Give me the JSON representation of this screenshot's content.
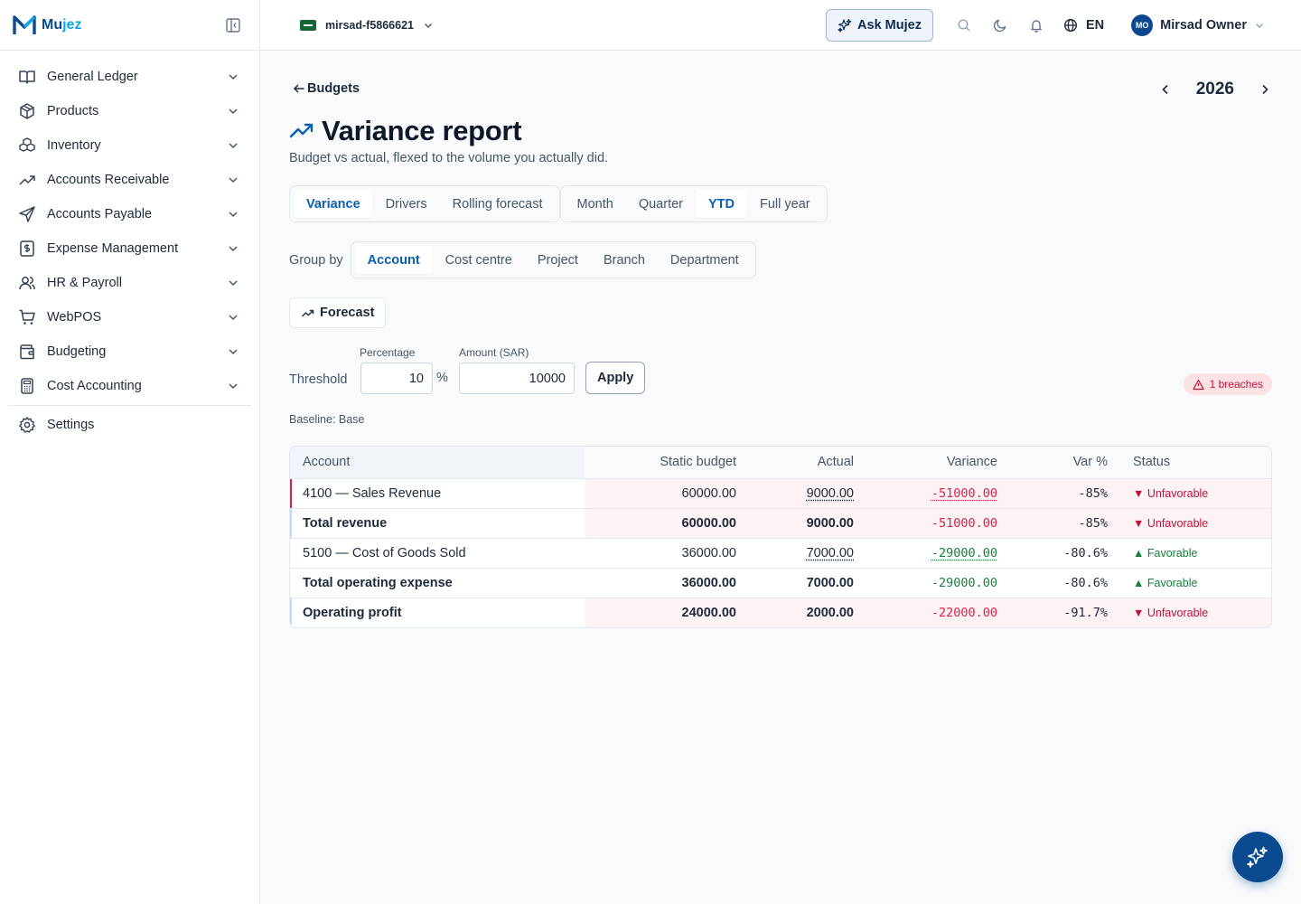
{
  "app": {
    "name_prefix": "Mu",
    "name_suffix": "jez"
  },
  "sidebar": {
    "items": [
      {
        "label": "General Ledger",
        "icon": "book-open-icon"
      },
      {
        "label": "Products",
        "icon": "box-icon"
      },
      {
        "label": "Inventory",
        "icon": "boxes-icon"
      },
      {
        "label": "Accounts Receivable",
        "icon": "trend-up-icon"
      },
      {
        "label": "Accounts Payable",
        "icon": "send-icon"
      },
      {
        "label": "Expense Management",
        "icon": "receipt-icon"
      },
      {
        "label": "HR & Payroll",
        "icon": "users-icon"
      },
      {
        "label": "WebPOS",
        "icon": "cart-icon"
      },
      {
        "label": "Budgeting",
        "icon": "wallet-icon"
      },
      {
        "label": "Cost Accounting",
        "icon": "calculator-icon"
      }
    ],
    "settings_label": "Settings"
  },
  "topbar": {
    "tenant": "mirsad-f5866621",
    "ask_label": "Ask Mujez",
    "language": "EN",
    "user_initials": "MO",
    "user_name": "Mirsad Owner"
  },
  "page": {
    "back_label": "Budgets",
    "year": "2026",
    "title": "Variance report",
    "subtitle": "Budget vs actual, flexed to the volume you actually did.",
    "view_tabs": [
      "Variance",
      "Drivers",
      "Rolling forecast"
    ],
    "view_active": "Variance",
    "period_tabs": [
      "Month",
      "Quarter",
      "YTD",
      "Full year"
    ],
    "period_active": "YTD",
    "group_by_label": "Group by",
    "group_tabs": [
      "Account",
      "Cost centre",
      "Project",
      "Branch",
      "Department"
    ],
    "group_active": "Account",
    "forecast_label": "Forecast",
    "threshold": {
      "label": "Threshold",
      "percentage_label": "Percentage",
      "percentage_value": "10",
      "percent_sign": "%",
      "amount_label": "Amount (SAR)",
      "amount_value": "10000",
      "apply_label": "Apply"
    },
    "breaches_label": "1 breaches",
    "baseline_label": "Baseline: Base"
  },
  "table": {
    "headers": {
      "account": "Account",
      "static_budget": "Static budget",
      "actual": "Actual",
      "variance": "Variance",
      "var_pct": "Var %",
      "status": "Status"
    },
    "rows": [
      {
        "account": "4100 — Sales Revenue",
        "budget": "60000.00",
        "actual": "9000.00",
        "variance": "-51000.00",
        "var_pct": "-85%",
        "status": "Unfavorable"
      },
      {
        "account": "Total revenue",
        "budget": "60000.00",
        "actual": "9000.00",
        "variance": "-51000.00",
        "var_pct": "-85%",
        "status": "Unfavorable"
      },
      {
        "account": "5100 — Cost of Goods Sold",
        "budget": "36000.00",
        "actual": "7000.00",
        "variance": "-29000.00",
        "var_pct": "-80.6%",
        "status": "Favorable"
      },
      {
        "account": "Total operating expense",
        "budget": "36000.00",
        "actual": "7000.00",
        "variance": "-29000.00",
        "var_pct": "-80.6%",
        "status": "Favorable"
      },
      {
        "account": "Operating profit",
        "budget": "24000.00",
        "actual": "2000.00",
        "variance": "-22000.00",
        "var_pct": "-91.7%",
        "status": "Unfavorable"
      }
    ]
  },
  "colors": {
    "brand": "#0b4a8f",
    "active_tab": "#0b5fae",
    "unfavorable": "#e11d48",
    "favorable": "#15803d"
  }
}
